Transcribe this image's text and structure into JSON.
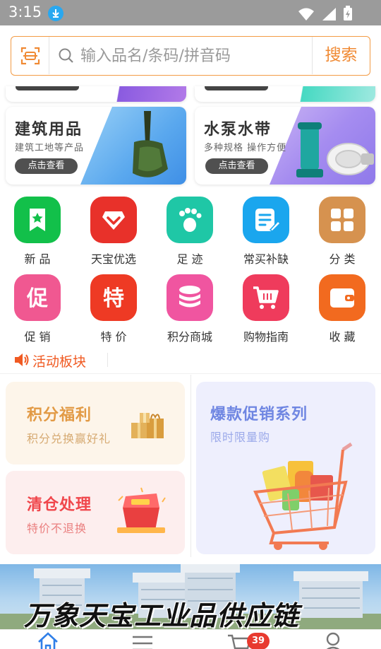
{
  "status_bar": {
    "time": "3:15"
  },
  "search": {
    "placeholder": "输入品名/条码/拼音码",
    "button": "搜索"
  },
  "banners": [
    {
      "title": "建筑用品",
      "subtitle": "建筑工地等产品",
      "button": "点击查看"
    },
    {
      "title": "水泵水带",
      "subtitle": "多种规格 操作方便",
      "button": "点击查看"
    }
  ],
  "grid": [
    {
      "label": "新 品",
      "icon": "new-star-icon",
      "color": "#12c04a"
    },
    {
      "label": "天宝优选",
      "icon": "diamond-icon",
      "color": "#e8312a"
    },
    {
      "label": "足 迹",
      "icon": "footprint-icon",
      "color": "#1fc7a6"
    },
    {
      "label": "常买补缺",
      "icon": "edit-list-icon",
      "color": "#1aa6ee"
    },
    {
      "label": "分 类",
      "icon": "category-icon",
      "color": "#d6924f"
    },
    {
      "label": "促 销",
      "icon": "promo-icon",
      "color": "#f05891"
    },
    {
      "label": "特 价",
      "icon": "special-price-icon",
      "color": "#ee3a24"
    },
    {
      "label": "积分商城",
      "icon": "coins-icon",
      "color": "#f055a0"
    },
    {
      "label": "购物指南",
      "icon": "cart-icon",
      "color": "#ef3b5c"
    },
    {
      "label": "收 藏",
      "icon": "wallet-icon",
      "color": "#f26a1f"
    }
  ],
  "activity": {
    "title": "活动板块",
    "cards": {
      "points": {
        "title": "积分福利",
        "subtitle": "积分兑换赢好礼"
      },
      "clearance": {
        "title": "清仓处理",
        "subtitle": "特价不退换"
      },
      "promo": {
        "title": "爆款促销系列",
        "subtitle": "限时限量购"
      }
    }
  },
  "bottom_banner": {
    "text": "万象天宝工业品供应链"
  },
  "tabbar": {
    "cart_badge": "39"
  },
  "colors": {
    "accent": "#f08a34",
    "activity": "#f05a22",
    "badge": "#e83a2f"
  }
}
